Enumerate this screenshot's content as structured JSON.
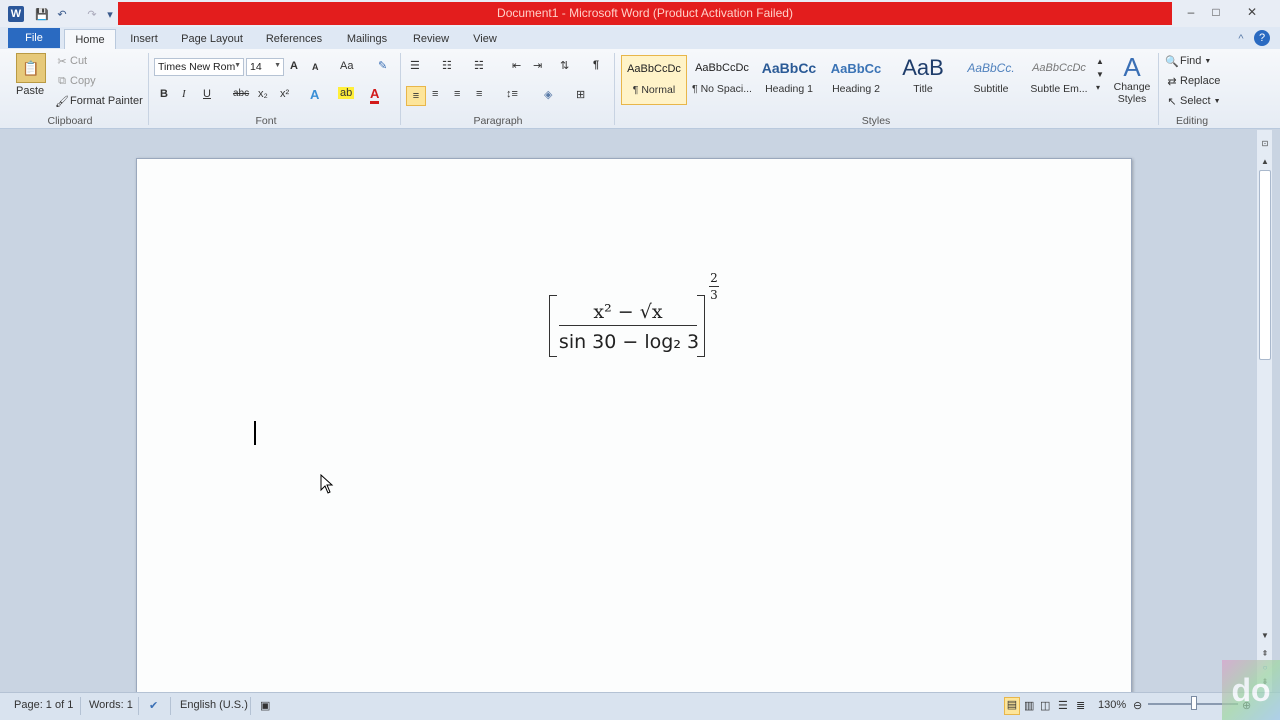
{
  "window": {
    "title": "Document1  -  Microsoft Word (Product Activation Failed)",
    "minimize": "–",
    "maximize": "□",
    "close": "✕"
  },
  "quick_access": {
    "word_icon": "W",
    "save": "💾",
    "undo": "↶",
    "redo": "↷",
    "customize": "▾"
  },
  "tabs": [
    "File",
    "Home",
    "Insert",
    "Page Layout",
    "References",
    "Mailings",
    "Review",
    "View"
  ],
  "active_tab": "Home",
  "clipboard": {
    "label": "Clipboard",
    "paste": "Paste",
    "cut": "Cut",
    "copy": "Copy",
    "format_painter": "Format Painter"
  },
  "font": {
    "label": "Font",
    "name": "Times New Rom",
    "size": "14",
    "grow": "A",
    "shrink": "A",
    "change_case": "Aa",
    "bold": "B",
    "italic": "I",
    "underline": "U",
    "strike": "abc",
    "subscript": "x₂",
    "superscript": "x²",
    "font_color": "A"
  },
  "paragraph": {
    "label": "Paragraph",
    "show_marks": "¶"
  },
  "styles": {
    "label": "Styles",
    "items": [
      {
        "sample": "AaBbCcDc",
        "name": "¶ Normal"
      },
      {
        "sample": "AaBbCcDc",
        "name": "¶ No Spaci..."
      },
      {
        "sample": "AaBbCc",
        "name": "Heading 1"
      },
      {
        "sample": "AaBbCc",
        "name": "Heading 2"
      },
      {
        "sample": "AaB",
        "name": "Title"
      },
      {
        "sample": "AaBbCc.",
        "name": "Subtitle"
      },
      {
        "sample": "AaBbCcDc",
        "name": "Subtle Em..."
      }
    ],
    "change_styles": "Change Styles"
  },
  "editing": {
    "label": "Editing",
    "find": "Find",
    "replace": "Replace",
    "select": "Select"
  },
  "equation": {
    "numerator": "x² − √x",
    "denominator": "sin 30 − log₂ 3",
    "exponent_num": "2",
    "exponent_den": "3"
  },
  "status": {
    "page": "Page: 1 of 1",
    "words": "Words: 1",
    "language": "English (U.S.)",
    "zoom": "130%"
  },
  "watermark": "do"
}
